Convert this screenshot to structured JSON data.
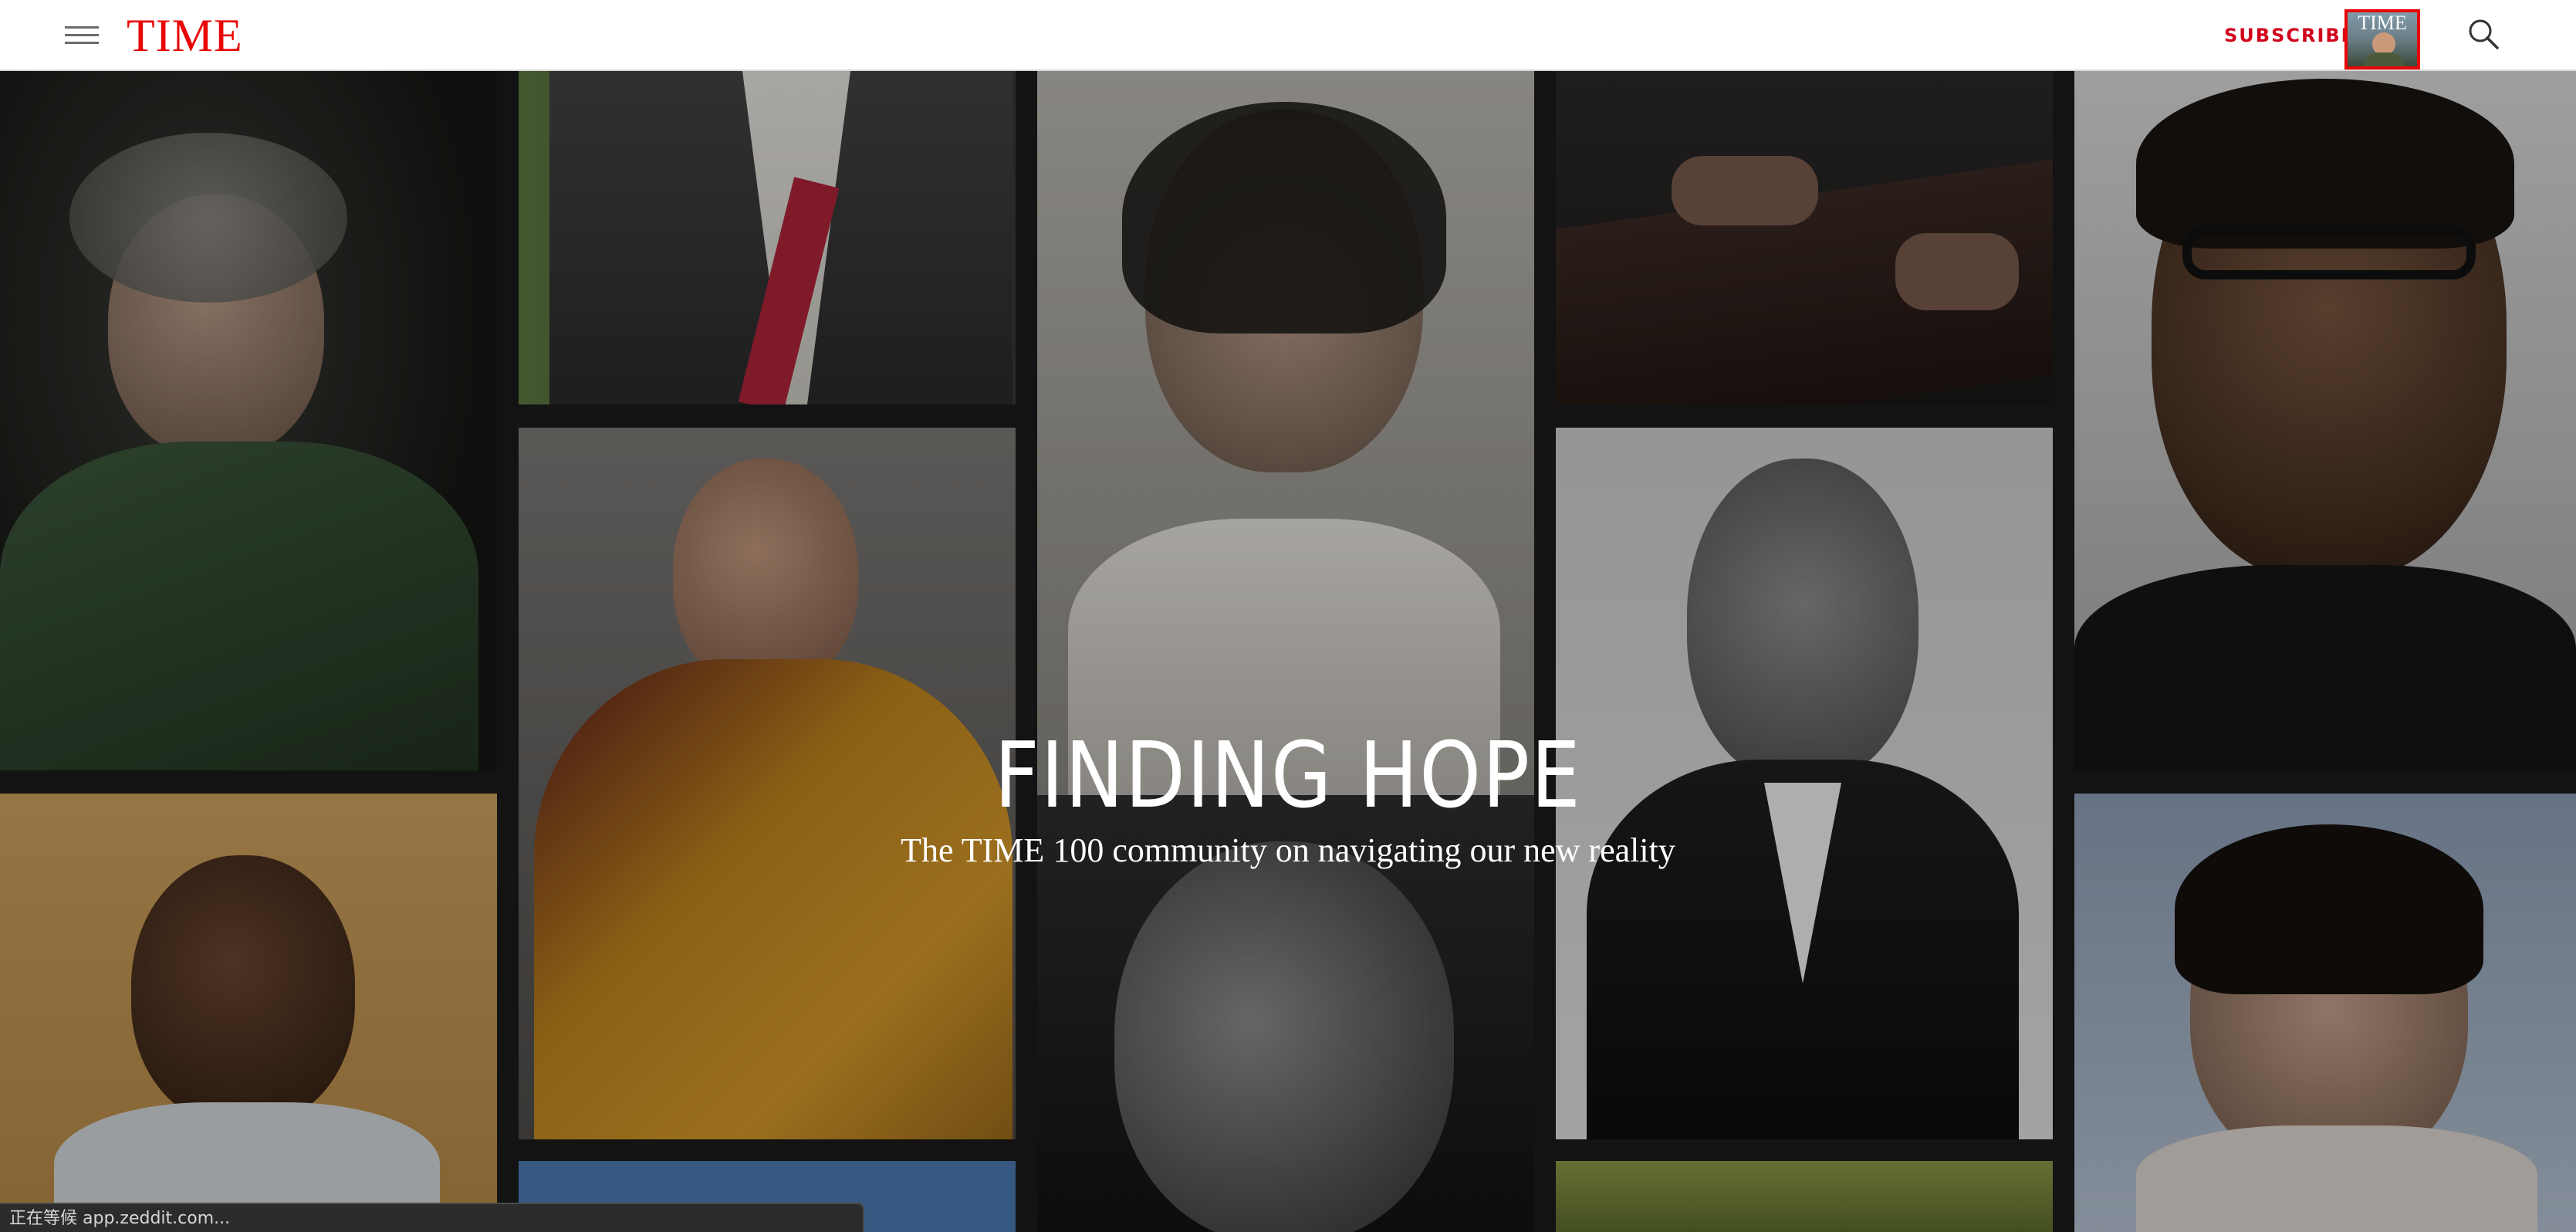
{
  "header": {
    "logo": "TIME",
    "subscribe_label": "SUBSCRIBE",
    "cover_logo": "TIME",
    "brand_color": "#e90606"
  },
  "hero": {
    "title": "FINDING HOPE",
    "subtitle": "The TIME 100 community on navigating our new reality"
  },
  "status_bar": {
    "text": "正在等候 app.zeddit.com..."
  },
  "icons": [
    "menu-icon",
    "search-icon"
  ]
}
